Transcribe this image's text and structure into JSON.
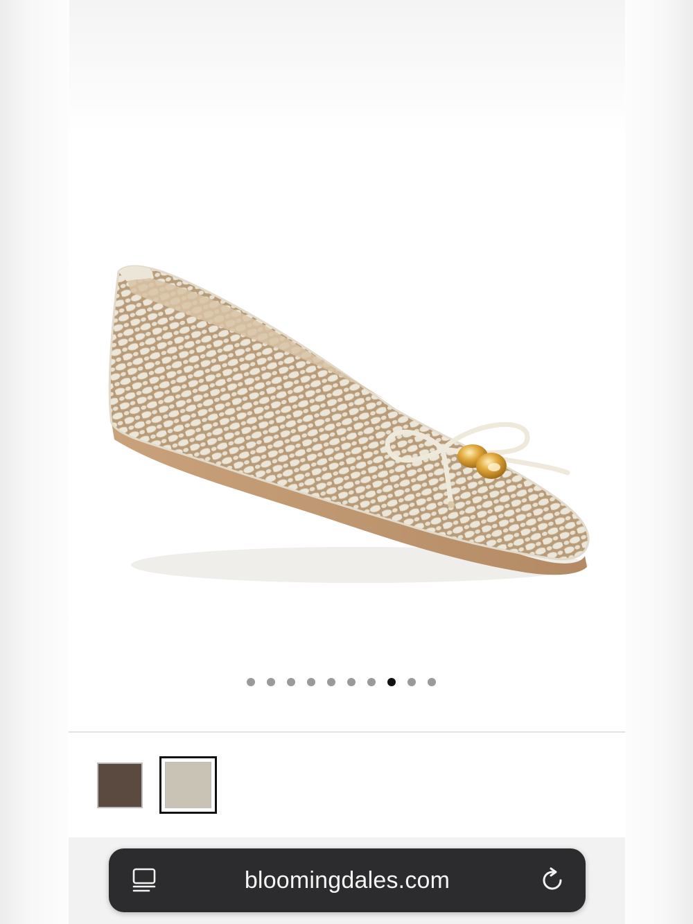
{
  "product": {
    "image_alt": "Woven cream ballet flat with bow and gold charms",
    "carousel": {
      "total": 10,
      "active_index": 7
    },
    "swatches": [
      {
        "name": "brown",
        "color": "#5a4a40",
        "selected": false
      },
      {
        "name": "cream",
        "color": "#c9c3b6",
        "selected": true
      }
    ]
  },
  "browser": {
    "url": "bloomingdales.com",
    "icons": {
      "left": "reader-icon",
      "right": "reload-icon"
    },
    "bar_color": "#2c2c2e"
  }
}
